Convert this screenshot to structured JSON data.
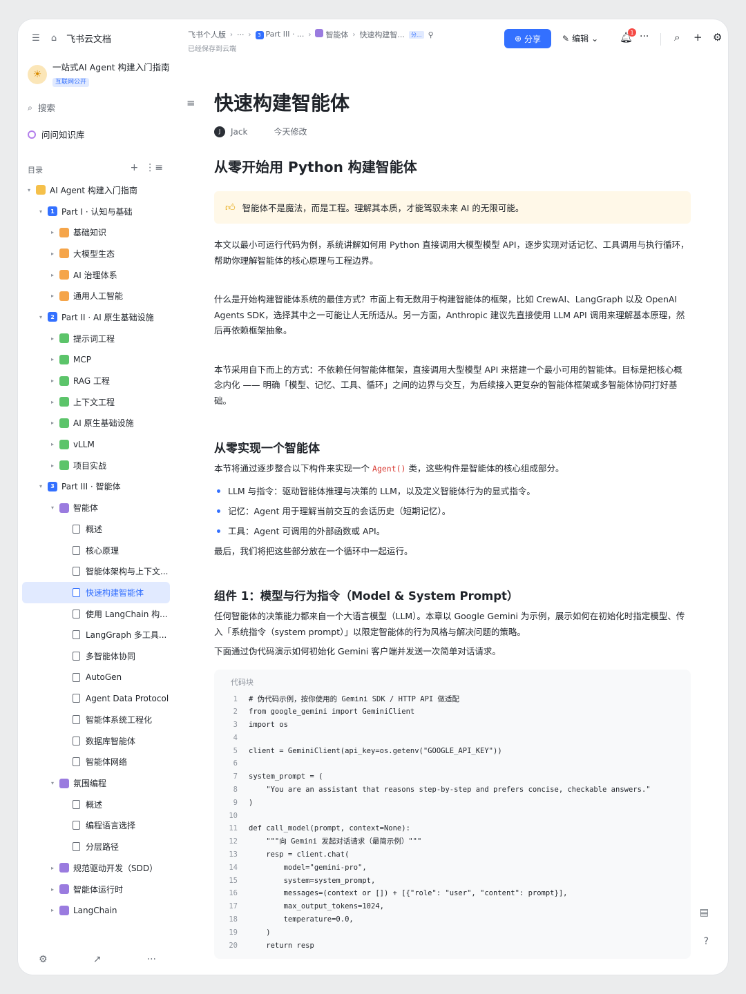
{
  "app": {
    "name": "飞书云文档"
  },
  "wiki": {
    "title": "一站式AI Agent 构建入门指南",
    "badge": "互联网公开"
  },
  "sidebar": {
    "search": "搜索",
    "ask": "问问知识库",
    "toc_label": "目录",
    "tree": [
      {
        "label": "AI Agent 构建入门指南",
        "level": 0,
        "arrow": "▾",
        "icon": "wiki",
        "color": "#f5c04a"
      },
      {
        "label": "Part I · 认知与基础",
        "level": 1,
        "arrow": "▾",
        "icon": "1",
        "color": "#3370ff"
      },
      {
        "label": "基础知识",
        "level": 2,
        "arrow": "▸",
        "icon": "",
        "color": "#f5a54a"
      },
      {
        "label": "大模型生态",
        "level": 2,
        "arrow": "▸",
        "icon": "",
        "color": "#f5a54a"
      },
      {
        "label": "AI 治理体系",
        "level": 2,
        "arrow": "▸",
        "icon": "",
        "color": "#f5a54a"
      },
      {
        "label": "通用人工智能",
        "level": 2,
        "arrow": "▸",
        "icon": "",
        "color": "#f5a54a"
      },
      {
        "label": "Part II · AI 原生基础设施",
        "level": 1,
        "arrow": "▾",
        "icon": "2",
        "color": "#3370ff"
      },
      {
        "label": "提示词工程",
        "level": 2,
        "arrow": "▸",
        "icon": "",
        "color": "#5cc46a"
      },
      {
        "label": "MCP",
        "level": 2,
        "arrow": "▸",
        "icon": "",
        "color": "#5cc46a"
      },
      {
        "label": "RAG 工程",
        "level": 2,
        "arrow": "▸",
        "icon": "",
        "color": "#5cc46a"
      },
      {
        "label": "上下文工程",
        "level": 2,
        "arrow": "▸",
        "icon": "",
        "color": "#5cc46a"
      },
      {
        "label": "AI 原生基础设施",
        "level": 2,
        "arrow": "▸",
        "icon": "",
        "color": "#5cc46a"
      },
      {
        "label": "vLLM",
        "level": 2,
        "arrow": "▸",
        "icon": "",
        "color": "#5cc46a"
      },
      {
        "label": "项目实战",
        "level": 2,
        "arrow": "▸",
        "icon": "",
        "color": "#5cc46a"
      },
      {
        "label": "Part III · 智能体",
        "level": 1,
        "arrow": "▾",
        "icon": "3",
        "color": "#3370ff"
      },
      {
        "label": "智能体",
        "level": 2,
        "arrow": "▾",
        "icon": "",
        "color": "#9a7bdf"
      },
      {
        "label": "概述",
        "level": 3,
        "arrow": "",
        "icon": "doc"
      },
      {
        "label": "核心原理",
        "level": 3,
        "arrow": "",
        "icon": "doc"
      },
      {
        "label": "智能体架构与上下文...",
        "level": 3,
        "arrow": "",
        "icon": "doc"
      },
      {
        "label": "快速构建智能体",
        "level": 3,
        "arrow": "",
        "icon": "doc",
        "active": true
      },
      {
        "label": "使用 LangChain 构...",
        "level": 3,
        "arrow": "",
        "icon": "doc"
      },
      {
        "label": "LangGraph 多工具...",
        "level": 3,
        "arrow": "",
        "icon": "doc"
      },
      {
        "label": "多智能体协同",
        "level": 3,
        "arrow": "",
        "icon": "doc"
      },
      {
        "label": "AutoGen",
        "level": 3,
        "arrow": "",
        "icon": "doc"
      },
      {
        "label": "Agent Data Protocol",
        "level": 3,
        "arrow": "",
        "icon": "doc"
      },
      {
        "label": "智能体系统工程化",
        "level": 3,
        "arrow": "",
        "icon": "doc"
      },
      {
        "label": "数据库智能体",
        "level": 3,
        "arrow": "",
        "icon": "doc"
      },
      {
        "label": "智能体网络",
        "level": 3,
        "arrow": "",
        "icon": "doc"
      },
      {
        "label": "氛围编程",
        "level": 2,
        "arrow": "▾",
        "icon": "",
        "color": "#9a7bdf"
      },
      {
        "label": "概述",
        "level": 3,
        "arrow": "",
        "icon": "doc"
      },
      {
        "label": "编程语言选择",
        "level": 3,
        "arrow": "",
        "icon": "doc"
      },
      {
        "label": "分层路径",
        "level": 3,
        "arrow": "",
        "icon": "doc"
      },
      {
        "label": "规范驱动开发（SDD）",
        "level": 2,
        "arrow": "▸",
        "icon": "",
        "color": "#9a7bdf"
      },
      {
        "label": "智能体运行时",
        "level": 2,
        "arrow": "▸",
        "icon": "",
        "color": "#9a7bdf"
      },
      {
        "label": "LangChain",
        "level": 2,
        "arrow": "▸",
        "icon": "",
        "color": "#9a7bdf"
      }
    ]
  },
  "header": {
    "crumb1": "飞书个人版",
    "crumb_more": "···",
    "crumb2": "Part III · ...",
    "crumb3": "智能体",
    "crumb4": "快速构建智...",
    "tag": "分...",
    "saved": "已经保存到云端",
    "share": "分享",
    "edit": "编辑",
    "bell_count": "1"
  },
  "doc": {
    "title": "快速构建智能体",
    "author": "Jack",
    "modified": "今天修改",
    "h2": "从零开始用 Python 构建智能体",
    "callout": "智能体不是魔法，而是工程。理解其本质，才能驾驭未来 AI 的无限可能。",
    "p1": "本文以最小可运行代码为例，系统讲解如何用 Python 直接调用大模型模型 API，逐步实现对话记忆、工具调用与执行循环，帮助你理解智能体的核心原理与工程边界。",
    "p2": "什么是开始构建智能体系统的最佳方式？市面上有无数用于构建智能体的框架，比如 CrewAI、LangGraph 以及 OpenAI Agents SDK，选择其中之一可能让人无所适从。另一方面，Anthropic 建议先直接使用 LLM API 调用来理解基本原理，然后再依赖框架抽象。",
    "p3": "本节采用自下而上的方式：不依赖任何智能体框架，直接调用大型模型 API 来搭建一个最小可用的智能体。目标是把核心概念内化 —— 明确「模型、记忆、工具、循环」之间的边界与交互，为后续接入更复杂的智能体框架或多智能体协同打好基础。",
    "h3": "从零实现一个智能体",
    "intro_a": "本节将通过逐步整合以下构件来实现一个",
    "intro_code": "Agent()",
    "intro_b": "类，这些构件是智能体的核心组成部分。",
    "bullets": [
      "LLM 与指令：驱动智能体推理与决策的 LLM，以及定义智能体行为的显式指令。",
      "记忆：Agent 用于理解当前交互的会话历史（短期记忆）。",
      "工具：Agent 可调用的外部函数或 API。"
    ],
    "after": "最后，我们将把这些部分放在一个循环中一起运行。",
    "comp_title": "组件 1：模型与行为指令（Model & System Prompt）",
    "comp_p1": "任何智能体的决策能力都来自一个大语言模型（LLM）。本章以 Google Gemini 为示例，展示如何在初始化时指定模型、传入「系统指令（system prompt）」以限定智能体的行为风格与解决问题的策略。",
    "comp_p2": "下面通过伪代码演示如何初始化 Gemini 客户端并发送一次简单对话请求。",
    "code_label": "代码块",
    "code": [
      "# 伪代码示例，按你使用的 Gemini SDK / HTTP API 做适配",
      "from google_gemini import GeminiClient",
      "import os",
      "",
      "client = GeminiClient(api_key=os.getenv(\"GOOGLE_API_KEY\"))",
      "",
      "system_prompt = (",
      "    \"You are an assistant that reasons step-by-step and prefers concise, checkable answers.\"",
      ")",
      "",
      "def call_model(prompt, context=None):",
      "    \"\"\"向 Gemini 发起对话请求（最简示例）\"\"\"",
      "    resp = client.chat(",
      "        model=\"gemini-pro\",",
      "        system=system_prompt,",
      "        messages=(context or []) + [{\"role\": \"user\", \"content\": prompt}],",
      "        max_output_tokens=1024,",
      "        temperature=0.0,",
      "    )",
      "    return resp"
    ],
    "line_numbers": [
      "1",
      "2",
      "3",
      "4",
      "5",
      "6",
      "7",
      "8",
      "9",
      "10",
      "11",
      "12",
      "13",
      "14",
      "15",
      "16",
      "17",
      "18",
      "19",
      "20"
    ]
  },
  "colors": {
    "accent": "#3370ff",
    "callout_bg": "#fff8e8"
  }
}
